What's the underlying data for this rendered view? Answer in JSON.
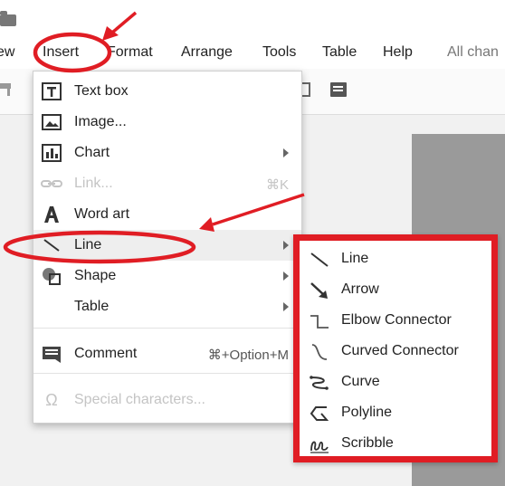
{
  "menubar": {
    "items": [
      {
        "label": "ew"
      },
      {
        "label": "Insert"
      },
      {
        "label": "Format"
      },
      {
        "label": "Arrange"
      },
      {
        "label": "Tools"
      },
      {
        "label": "Table"
      },
      {
        "label": "Help"
      },
      {
        "label": "All chan"
      }
    ]
  },
  "insert_menu": {
    "items": [
      {
        "label": "Text box",
        "icon": "text-box-icon"
      },
      {
        "label": "Image...",
        "icon": "image-icon"
      },
      {
        "label": "Chart",
        "icon": "chart-icon",
        "submenu": true
      },
      {
        "label": "Link...",
        "icon": "link-icon",
        "shortcut": "⌘K",
        "disabled": true
      },
      {
        "label": "Word art",
        "icon": "word-art-icon"
      },
      {
        "label": "Line",
        "icon": "line-icon",
        "submenu": true,
        "highlighted": true
      },
      {
        "label": "Shape",
        "icon": "shape-icon",
        "submenu": true
      },
      {
        "label": "Table",
        "submenu": true
      },
      {
        "label": "Comment",
        "icon": "comment-icon",
        "shortcut": "⌘+Option+M"
      },
      {
        "label": "Special characters...",
        "icon": "omega-icon",
        "disabled": true
      }
    ]
  },
  "line_submenu": {
    "items": [
      {
        "label": "Line",
        "icon": "line-icon"
      },
      {
        "label": "Arrow",
        "icon": "arrow-icon"
      },
      {
        "label": "Elbow Connector",
        "icon": "elbow-connector-icon"
      },
      {
        "label": "Curved Connector",
        "icon": "curved-connector-icon"
      },
      {
        "label": "Curve",
        "icon": "curve-icon"
      },
      {
        "label": "Polyline",
        "icon": "polyline-icon"
      },
      {
        "label": "Scribble",
        "icon": "scribble-icon"
      }
    ]
  },
  "colors": {
    "annotation_red": "#e01d24",
    "highlight": "#eeeeee",
    "disabled_text": "#c4c4c4"
  }
}
